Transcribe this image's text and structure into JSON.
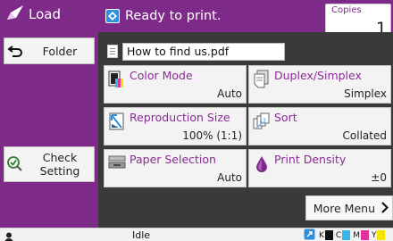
{
  "left_panel": {
    "title": "Load",
    "folder_label": "Folder",
    "check_setting_label": "Check\nSetting"
  },
  "topbar": {
    "status": "Ready to print.",
    "copies_label": "Copies",
    "copies_value": "1"
  },
  "file": {
    "name": "How to find us.pdf"
  },
  "tiles": [
    {
      "label": "Color Mode",
      "value": "Auto",
      "icon": "color-mode-icon"
    },
    {
      "label": "Duplex/Simplex",
      "value": "Simplex",
      "icon": "duplex-icon"
    },
    {
      "label": "Reproduction Size",
      "value": "100% (1:1)",
      "icon": "reproduction-size-icon"
    },
    {
      "label": "Sort",
      "value": "Collated",
      "icon": "sort-icon"
    },
    {
      "label": "Paper Selection",
      "value": "Auto",
      "icon": "paper-tray-icon"
    },
    {
      "label": "Print Density",
      "value": "±0",
      "icon": "density-drop-icon"
    }
  ],
  "more_menu": {
    "label": "More Menu"
  },
  "statusbar": {
    "state": "Idle",
    "toner": [
      {
        "label": "K",
        "color": "#111111"
      },
      {
        "label": "C",
        "color": "#35b7e8"
      },
      {
        "label": "M",
        "color": "#e0309a"
      },
      {
        "label": "Y",
        "color": "#f5e400"
      }
    ]
  }
}
